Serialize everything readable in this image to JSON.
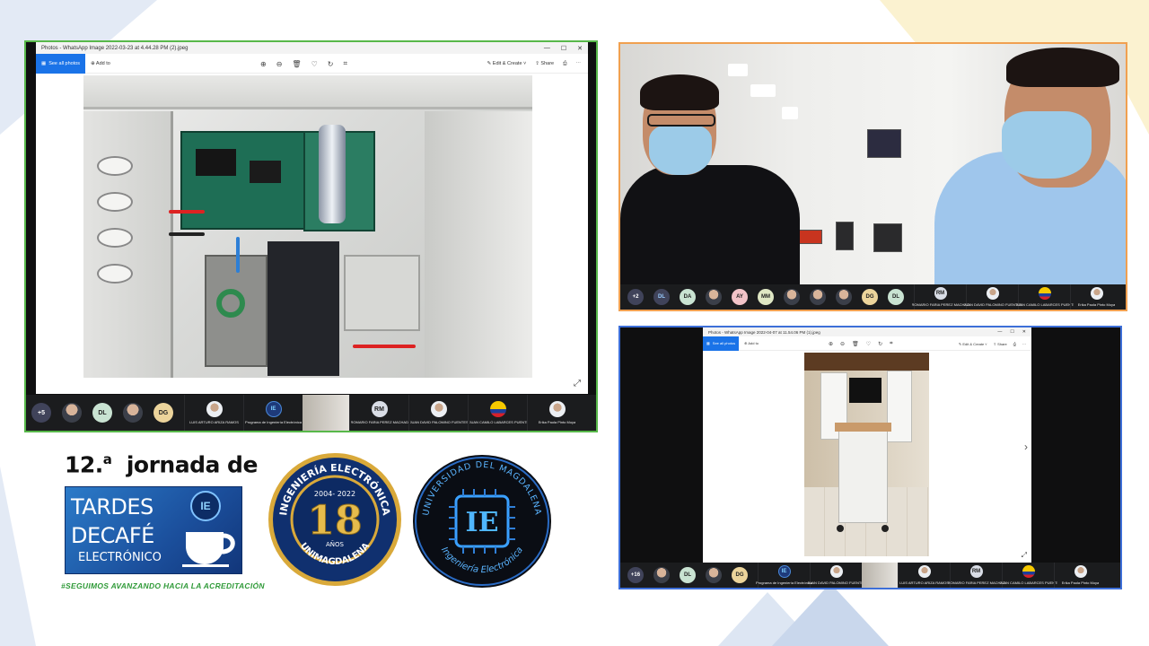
{
  "left_panel": {
    "window_title": "Photos - WhatsApp Image 2022-03-23 at 4.44.28 PM (2).jpeg",
    "see_all": "See all photos",
    "add_to": "Add to",
    "edit_create": "Edit & Create",
    "share": "Share",
    "participants_more": "+5",
    "chips": [
      "DL",
      "DG"
    ],
    "tiles": [
      {
        "name": "LUIS ARTURO ARIZA RAMOS",
        "initials": ""
      },
      {
        "name": "Programa de Ingeniería Electrónica",
        "initials": "IE"
      },
      {
        "name": "",
        "initials": ""
      },
      {
        "name": "ROMARIO FARIA PEREZ MACHADO",
        "initials": "RM"
      },
      {
        "name": "JUAN DAVID PALOMINO FUENTES",
        "initials": ""
      },
      {
        "name": "JUAN CAMILO LABARCES PUENTES",
        "initials": ""
      },
      {
        "name": "Erika Paola Pinto Moya",
        "initials": ""
      }
    ]
  },
  "top_right_panel": {
    "participants_more": "+2",
    "chips": [
      "DL",
      "DA",
      "AY",
      "MM",
      "DG",
      "DL"
    ],
    "tiles": [
      {
        "name": "ROMARIO FARIA PEREZ MACHADO",
        "initials": "RM"
      },
      {
        "name": "JUAN DAVID PALOMINO FUENTES",
        "initials": ""
      },
      {
        "name": "JUAN CAMILO LABARCES PUENTES",
        "initials": ""
      },
      {
        "name": "Erika Paola Pinto Moya",
        "initials": ""
      }
    ]
  },
  "bottom_right_panel": {
    "window_title": "Photos - WhatsApp Image 2022-04-07 at 11.54.06 PM (1).jpeg",
    "see_all": "See all photos",
    "add_to": "Add to",
    "edit_create": "Edit & Create",
    "share": "Share",
    "participants_more": "+16",
    "chips": [
      "DL",
      "DG"
    ],
    "tiles": [
      {
        "name": "Programa de Ingeniería Electrónica",
        "initials": "IE"
      },
      {
        "name": "JUAN DAVID PALOMINO FUENTES",
        "initials": ""
      },
      {
        "name": "",
        "initials": ""
      },
      {
        "name": "LUIS ARTURO ARIZA RAMOS",
        "initials": ""
      },
      {
        "name": "ROMARIO FARIA PEREZ MACHADO",
        "initials": "RM"
      },
      {
        "name": "JUAN CAMILO LABARCES PUENTES",
        "initials": ""
      },
      {
        "name": "Erika Paola Pinto Moya",
        "initials": ""
      }
    ]
  },
  "branding": {
    "title_num": "12.",
    "title_sup": "a",
    "title_rest": "jornada de",
    "line1": "TARDES",
    "line2": "DECAFÉ",
    "line3": "ELECTRÓNICO",
    "badge": "IE",
    "slogan": "#SEGUIMOS AVANZANDO HACIA LA ACREDITACIÓN"
  },
  "seal_18": {
    "top_text": "INGENIERÍA ELECTRÓNICA",
    "years": "2004- 2022",
    "number": "18",
    "sub": "AÑOS",
    "bottom_text": "UNIMAGDALENA"
  },
  "seal_ie": {
    "top_text": "UNIVERSIDAD DEL MAGDALENA",
    "center": "IE",
    "bottom_text": "Ingeniería Electrónica"
  },
  "colors": {
    "left_border": "#58b84a",
    "top_right_border": "#f0a050",
    "bottom_right_border": "#3d6fd8",
    "brand_blue": "#1b4f9c",
    "slogan_green": "#2f9a38",
    "gold": "#e0b040"
  },
  "icons": [
    "zoom-in-icon",
    "zoom-out-icon",
    "delete-icon",
    "favorite-icon",
    "rotate-icon",
    "crop-icon",
    "print-icon",
    "more-icon",
    "expand-icon",
    "next-arrow-icon",
    "coffee-cup-icon"
  ]
}
